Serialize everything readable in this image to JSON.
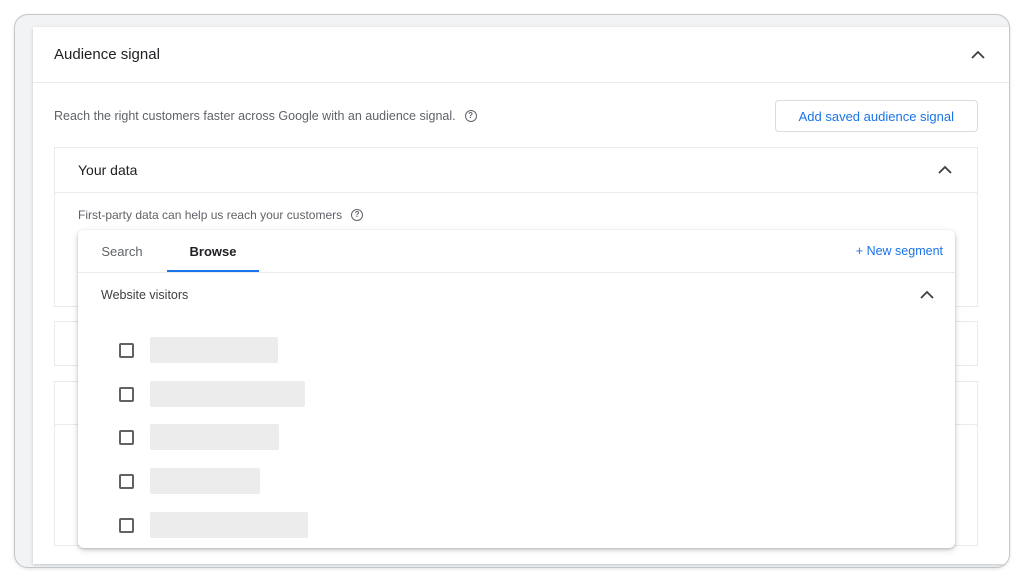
{
  "audience": {
    "title": "Audience signal",
    "description": "Reach the right customers faster across Google with an audience signal.",
    "add_button": "Add saved audience signal"
  },
  "your_data": {
    "title": "Your data",
    "description": "First-party data can help us reach your customers"
  },
  "picker": {
    "tabs": [
      "Search",
      "Browse"
    ],
    "active_tab": "Browse",
    "new_segment": "+ New segment",
    "group_label": "Website visitors",
    "items_checked": [
      false,
      false,
      false,
      false,
      false
    ]
  },
  "colors": {
    "accent": "#1a73e8",
    "placeholder": "#ececec"
  }
}
